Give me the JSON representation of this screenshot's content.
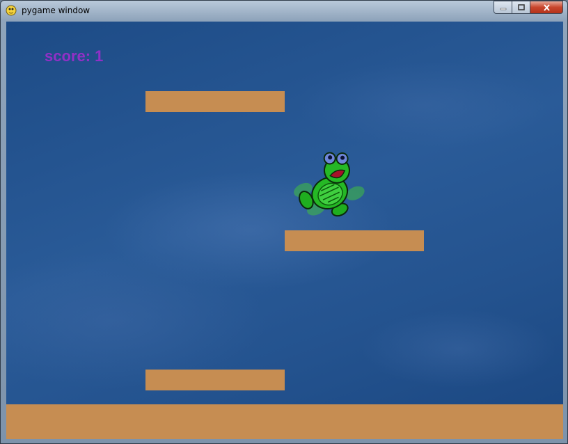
{
  "window": {
    "title": "pygame window"
  },
  "game": {
    "score_text": "score: 1",
    "score_color": "#9130c6",
    "platform_color": "#c68d52",
    "player": {
      "sprite": "turtle",
      "icon": "turtle-sprite"
    }
  }
}
